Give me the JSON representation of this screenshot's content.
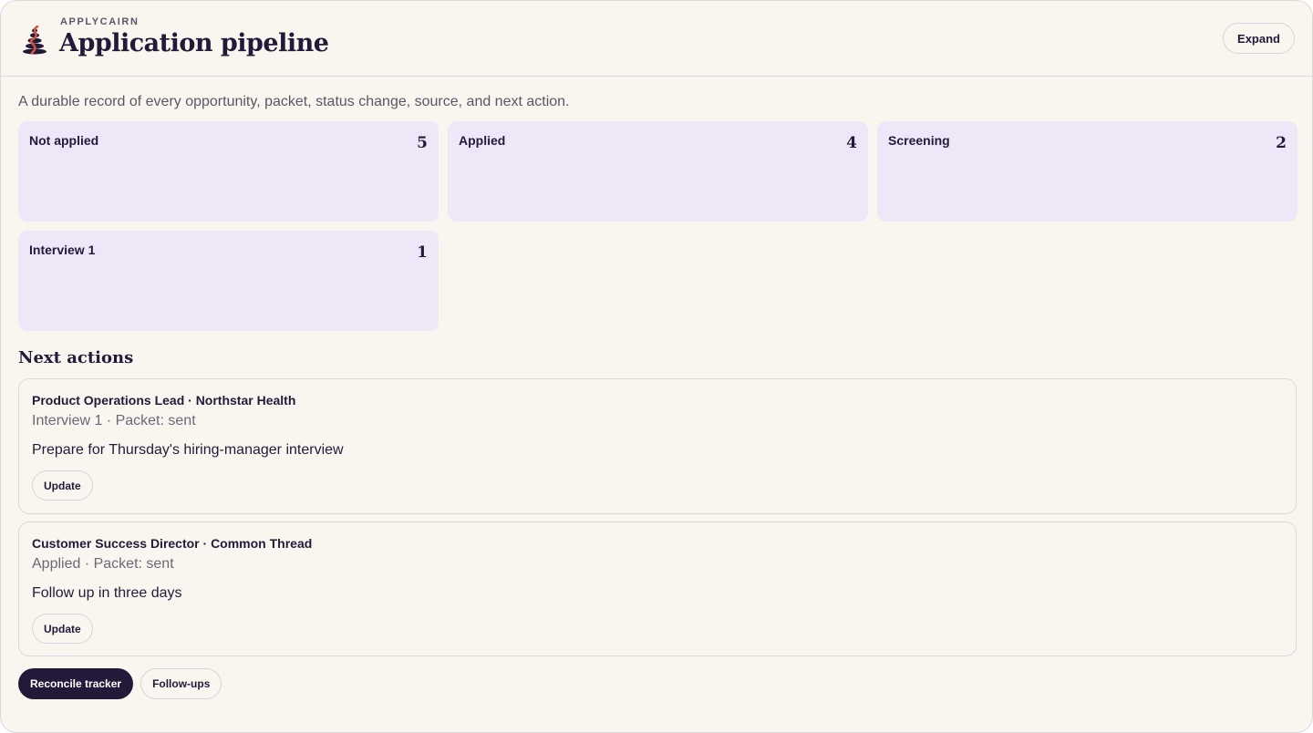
{
  "header": {
    "brand": "APPLYCAIRN",
    "title": "Application pipeline",
    "expand_label": "Expand",
    "logo_icon": "cairn-logo-icon"
  },
  "subtitle": "A durable record of every opportunity, packet, status change, source, and next action.",
  "stages": [
    {
      "name": "Not applied",
      "count": "5"
    },
    {
      "name": "Applied",
      "count": "4"
    },
    {
      "name": "Screening",
      "count": "2"
    },
    {
      "name": "Interview 1",
      "count": "1"
    }
  ],
  "next_actions": {
    "title": "Next actions",
    "items": [
      {
        "title": "Product Operations Lead · Northstar Health",
        "meta": "Interview 1 · Packet: sent",
        "note": "Prepare for Thursday's hiring-manager interview",
        "button": "Update"
      },
      {
        "title": "Customer Success Director · Common Thread",
        "meta": "Applied · Packet: sent",
        "note": "Follow up in three days",
        "button": "Update"
      }
    ]
  },
  "footer": {
    "primary_label": "Reconcile tracker",
    "secondary_label": "Follow-ups"
  },
  "colors": {
    "background": "#faf6ef",
    "ink": "#231a3a",
    "stage_card": "#ede7f8",
    "accent": "#d4553a"
  }
}
